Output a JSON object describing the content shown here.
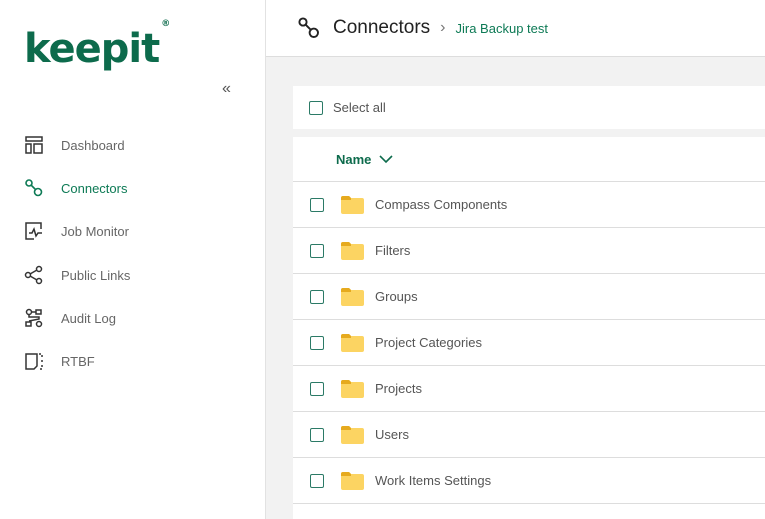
{
  "logo": "keepit",
  "sidebar": {
    "collapse": "«",
    "items": [
      {
        "label": "Dashboard",
        "icon": "dashboard-icon"
      },
      {
        "label": "Connectors",
        "icon": "connectors-icon",
        "active": true
      },
      {
        "label": "Job Monitor",
        "icon": "job-monitor-icon"
      },
      {
        "label": "Public Links",
        "icon": "share-icon"
      },
      {
        "label": "Audit Log",
        "icon": "audit-log-icon"
      },
      {
        "label": "RTBF",
        "icon": "rtbf-icon"
      }
    ]
  },
  "header": {
    "title": "Connectors",
    "breadcrumb": "Jira Backup test"
  },
  "select_all": "Select all",
  "list": {
    "column": "Name",
    "rows": [
      "Compass Components",
      "Filters",
      "Groups",
      "Project Categories",
      "Projects",
      "Users",
      "Work Items Settings"
    ]
  },
  "colors": {
    "accent": "#0d6b4c",
    "folder": "#fcd462"
  }
}
